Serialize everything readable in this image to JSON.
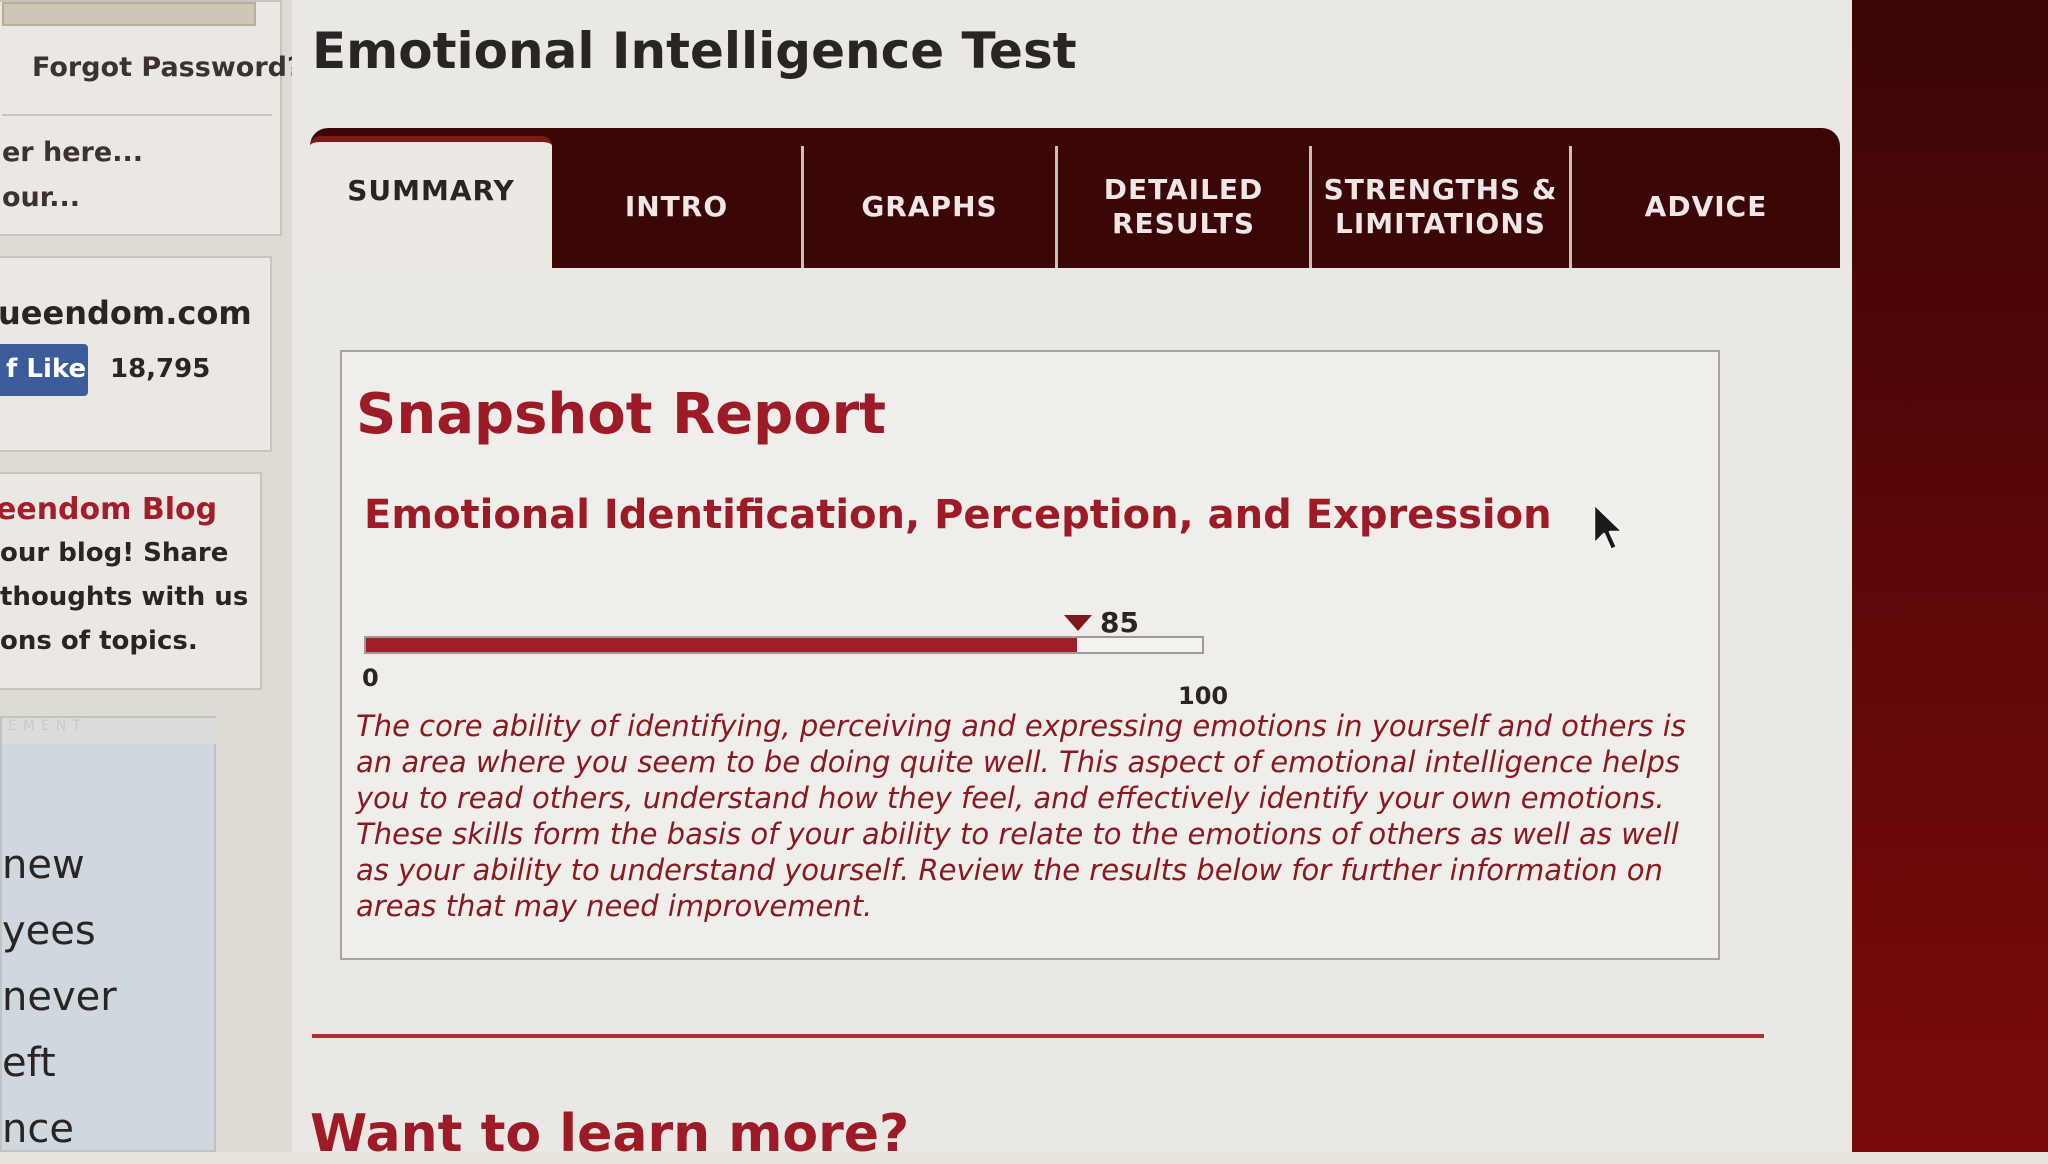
{
  "sidebar": {
    "login": {
      "forgot_password": "Forgot Password?...",
      "register_line": "er here...",
      "your_line": "our..."
    },
    "social": {
      "site_name": "ueendom.com",
      "like_label": "Like",
      "like_count": "18,795"
    },
    "blog": {
      "title": "eendom Blog",
      "lines": [
        "our blog! Share",
        "thoughts with us",
        "ons of topics."
      ]
    },
    "ad": {
      "header": "EMENT",
      "lines": [
        "new",
        "yees",
        "never",
        "eft",
        "nce"
      ]
    }
  },
  "page": {
    "title": "Emotional Intelligence Test"
  },
  "tabs": [
    {
      "label": "SUMMARY",
      "active": true
    },
    {
      "label": "INTRO",
      "active": false
    },
    {
      "label": "GRAPHS",
      "active": false
    },
    {
      "label": "DETAILED\nRESULTS",
      "active": false
    },
    {
      "label": "STRENGTHS &\nLIMITATIONS",
      "active": false
    },
    {
      "label": "ADVICE",
      "active": false
    }
  ],
  "report": {
    "title": "Snapshot Report",
    "section_title": "Emotional Identification, Perception, and Expression",
    "score": 85,
    "score_label": "85",
    "scale_min": "0",
    "scale_max": "100",
    "description": "The core ability of identifying, perceiving and expressing emotions in yourself and others is an area where you seem to be doing quite well. This aspect of emotional intelligence helps you to read others, understand how they feel, and effectively identify your own emotions. These skills form the basis of your ability to relate to the emotions of others as well as well as your ability to understand yourself. Review the results below for further information on areas that may need improvement."
  },
  "learn_more": "Want to learn more?",
  "colors": {
    "accent": "#9c1b27",
    "tab_bar": "#3a0606",
    "bar_fill": "#a21c2b",
    "facebook": "#3b5b9a"
  },
  "icons": {
    "marker": "down-triangle",
    "cursor": "mouse-pointer-arrow",
    "facebook": "facebook-f"
  }
}
